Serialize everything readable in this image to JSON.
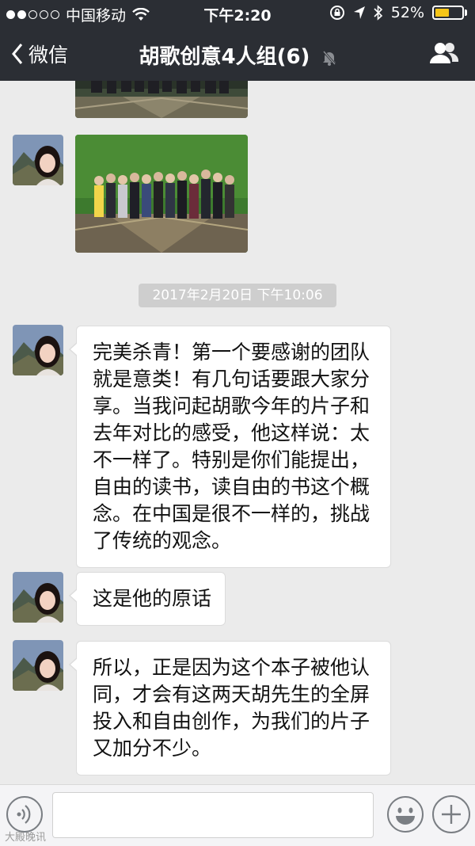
{
  "status_bar": {
    "carrier": "中国移动",
    "time": "下午2:20",
    "battery_percent": "52%",
    "battery_level": 0.52,
    "signal_bars_filled": 2,
    "signal_bars_total": 5,
    "battery_color": "#f5c518"
  },
  "nav": {
    "back_label": "微信",
    "title": "胡歌创意4人组(6)",
    "icons": [
      "chevron-left-icon",
      "mute-icon",
      "group-members-icon"
    ]
  },
  "chat": {
    "timestamp": "2017年2月20日 下午10:06",
    "messages": [
      {
        "type": "image",
        "description": "group-photo-partial"
      },
      {
        "type": "image",
        "description": "group-photo-green-screen"
      },
      {
        "type": "text",
        "text": "完美杀青！第一个要感谢的团队就是意类！有几句话要跟大家分享。当我问起胡歌今年的片子和去年对比的感受，他这样说：太不一样了。特别是你们能提出，自由的读书，读自由的书这个概念。在中国是很不一样的，挑战了传统的观念。"
      },
      {
        "type": "text",
        "text": "这是他的原话"
      },
      {
        "type": "text",
        "text": "所以，正是因为这个本子被他认同，才会有这两天胡先生的全屏投入和自由创作，为我们的片子又加分不少。"
      }
    ]
  },
  "input_bar": {
    "placeholder": "",
    "icons": [
      "voice-icon",
      "emoji-icon",
      "plus-icon"
    ]
  },
  "watermark": "大殿晚讯",
  "colors": {
    "nav_background": "#2b2e34",
    "chat_background": "#ebebeb",
    "bubble_background": "#ffffff",
    "timestamp_background": "#cecece"
  }
}
